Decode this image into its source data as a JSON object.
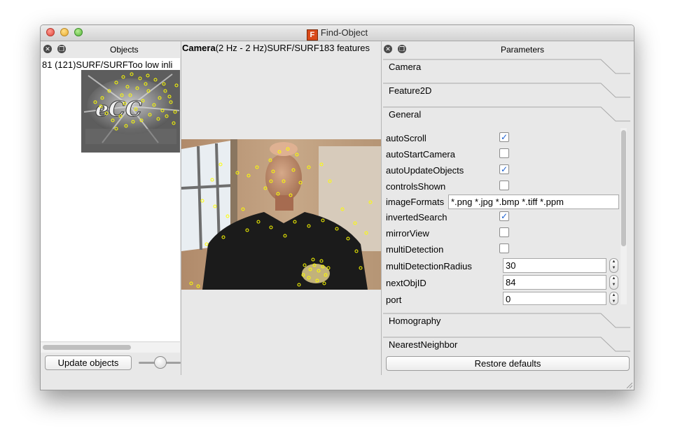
{
  "window": {
    "title": "Find-Object",
    "app_icon_letter": "F"
  },
  "objects_dock": {
    "title": "Objects",
    "object_label": "81 (121)SURF/SURFToo low inli",
    "update_button": "Update objects"
  },
  "camera_dock": {
    "label_bold": "Camera",
    "label_rest": "(2 Hz - 2 Hz)SURF/SURF183 features"
  },
  "parameters_dock": {
    "title": "Parameters",
    "tabs": [
      "Camera",
      "Feature2D",
      "General",
      "Homography",
      "NearestNeighbor"
    ],
    "properties": [
      {
        "name": "autoScroll",
        "type": "checkbox",
        "checked": true
      },
      {
        "name": "autoStartCamera",
        "type": "checkbox",
        "checked": false
      },
      {
        "name": "autoUpdateObjects",
        "type": "checkbox",
        "checked": true
      },
      {
        "name": "controlsShown",
        "type": "checkbox",
        "checked": false
      },
      {
        "name": "imageFormats",
        "type": "text",
        "value": "*.png *.jpg *.bmp *.tiff *.ppm"
      },
      {
        "name": "invertedSearch",
        "type": "checkbox",
        "checked": true
      },
      {
        "name": "mirrorView",
        "type": "checkbox",
        "checked": false
      },
      {
        "name": "multiDetection",
        "type": "checkbox",
        "checked": false
      },
      {
        "name": "multiDetectionRadius",
        "type": "spin",
        "value": "30"
      },
      {
        "name": "nextObjID",
        "type": "spin",
        "value": "84"
      },
      {
        "name": "port",
        "type": "spin",
        "value": "0"
      }
    ],
    "restore_button": "Restore defaults"
  },
  "colors": {
    "feature_points": "#ffff00",
    "checkbox_check": "#1a5fd0",
    "window_bg": "#e8e8e8"
  }
}
